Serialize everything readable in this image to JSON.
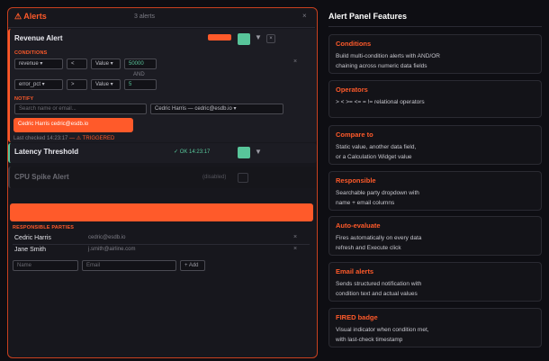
{
  "panel": {
    "title": "⚠ Alerts",
    "count": "3 alerts",
    "close": "×"
  },
  "alerts": [
    {
      "name": "Revenue Alert",
      "conditions_label": "CONDITIONS",
      "cond1": {
        "field": "revenue ▾",
        "op": "<",
        "type": "Value ▾",
        "value": "50000"
      },
      "and_label": "AND",
      "cond2": {
        "field": "error_pct ▾",
        "op": ">",
        "type": "Value ▾",
        "value": "5"
      },
      "remove": "×",
      "notify_label": "NOTIFY",
      "search_placeholder": "Search name or email...",
      "selected_party": "Cedric Harris — cedric@esdb.io ▾",
      "chip": "Cedric Harris cedric@esdb.io",
      "last_checked": "Last checked 14:23:17",
      "triggered": "— ⚠ TRIGGERED",
      "color": "#ff5a2a"
    },
    {
      "name": "Latency Threshold",
      "status": "✓ OK 14:23:17",
      "color": "#58c59a"
    },
    {
      "name": "CPU Spike Alert",
      "disabled": "(disabled)"
    }
  ],
  "parties": {
    "label": "RESPONSIBLE PARTIES",
    "rows": [
      {
        "name": "Cedric Harris",
        "email": "cedric@esdb.io",
        "remove": "×"
      },
      {
        "name": "Jane Smith",
        "email": "j.smith@airline.com",
        "remove": "×"
      }
    ],
    "name_placeholder": "Name",
    "email_placeholder": "Email",
    "add_label": "+ Add"
  },
  "features": {
    "title": "Alert Panel Features",
    "items": [
      {
        "name": "Conditions",
        "desc1": "Build multi-condition alerts with AND/OR",
        "desc2": "chaining across numeric data fields"
      },
      {
        "name": "Operators",
        "desc1": "> < >= <= = !=  relational operators",
        "desc2": ""
      },
      {
        "name": "Compare to",
        "desc1": "Static value, another data field,",
        "desc2": "or a Calculation Widget value"
      },
      {
        "name": "Responsible",
        "desc1": "Searchable party dropdown with",
        "desc2": "name + email columns"
      },
      {
        "name": "Auto-evaluate",
        "desc1": "Fires automatically on every data",
        "desc2": "refresh and Execute click"
      },
      {
        "name": "Email alerts",
        "desc1": "Sends structured notification with",
        "desc2": "condition text and actual values"
      },
      {
        "name": "FIRED badge",
        "desc1": "Visual indicator when condition met,",
        "desc2": "with last-check timestamp"
      }
    ]
  },
  "colors": {
    "accent": "#ff5a2a",
    "ok": "#58c59a",
    "bg": "#0e0e13"
  }
}
